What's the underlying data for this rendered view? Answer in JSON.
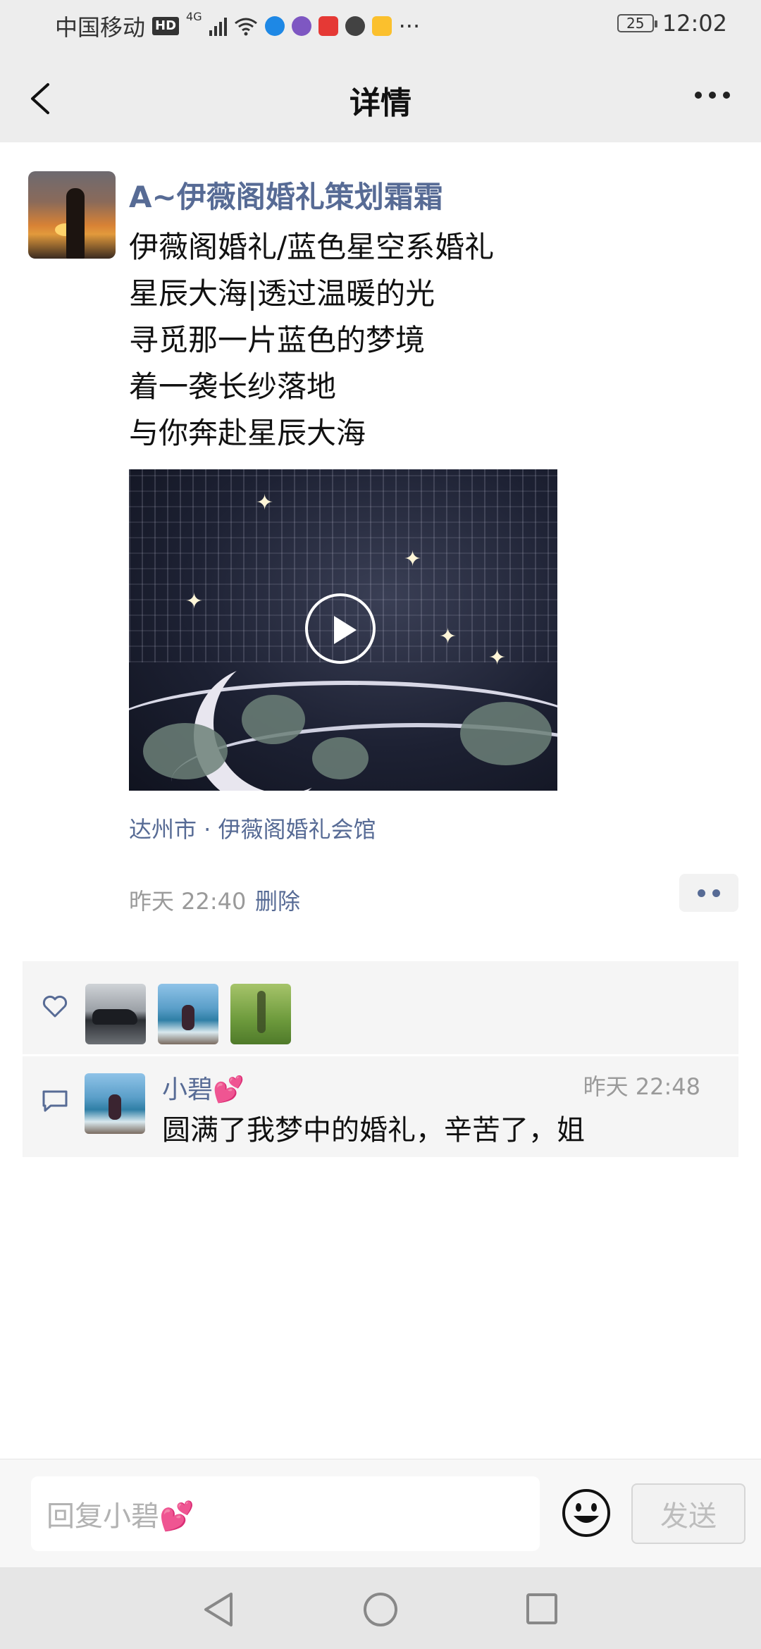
{
  "status_bar": {
    "carrier": "中国移动",
    "hd_badge": "HD",
    "network": "4G",
    "more": "···",
    "battery": "25",
    "time": "12:02"
  },
  "header": {
    "title": "详情",
    "back_icon": "chevron-left-icon",
    "more_icon": "more-horizontal-icon"
  },
  "post": {
    "author": "A~伊薇阁婚礼策划霜霜",
    "lines": [
      "伊薇阁婚礼/蓝色星空系婚礼",
      "星辰大海|透过温暖的光",
      "寻觅那一片蓝色的梦境",
      "着一袭长纱落地",
      "与你奔赴星辰大海"
    ],
    "location": "达州市 · 伊薇阁婚礼会馆",
    "time": "昨天 22:40",
    "delete_label": "删除"
  },
  "likes": {
    "icon": "heart-outline-icon",
    "count_avatars": 3
  },
  "comment": {
    "icon": "comment-bubble-icon",
    "name": "小碧💕",
    "time": "昨天 22:48",
    "text": "圆满了我梦中的婚礼，辛苦了，姐"
  },
  "reply": {
    "placeholder": "回复小碧💕",
    "send_label": "发送",
    "emoji_icon": "smiley-face-icon"
  },
  "colors": {
    "link_blue": "#576b95",
    "header_bg": "#ededed",
    "secondary_text": "#9a9a9a"
  }
}
